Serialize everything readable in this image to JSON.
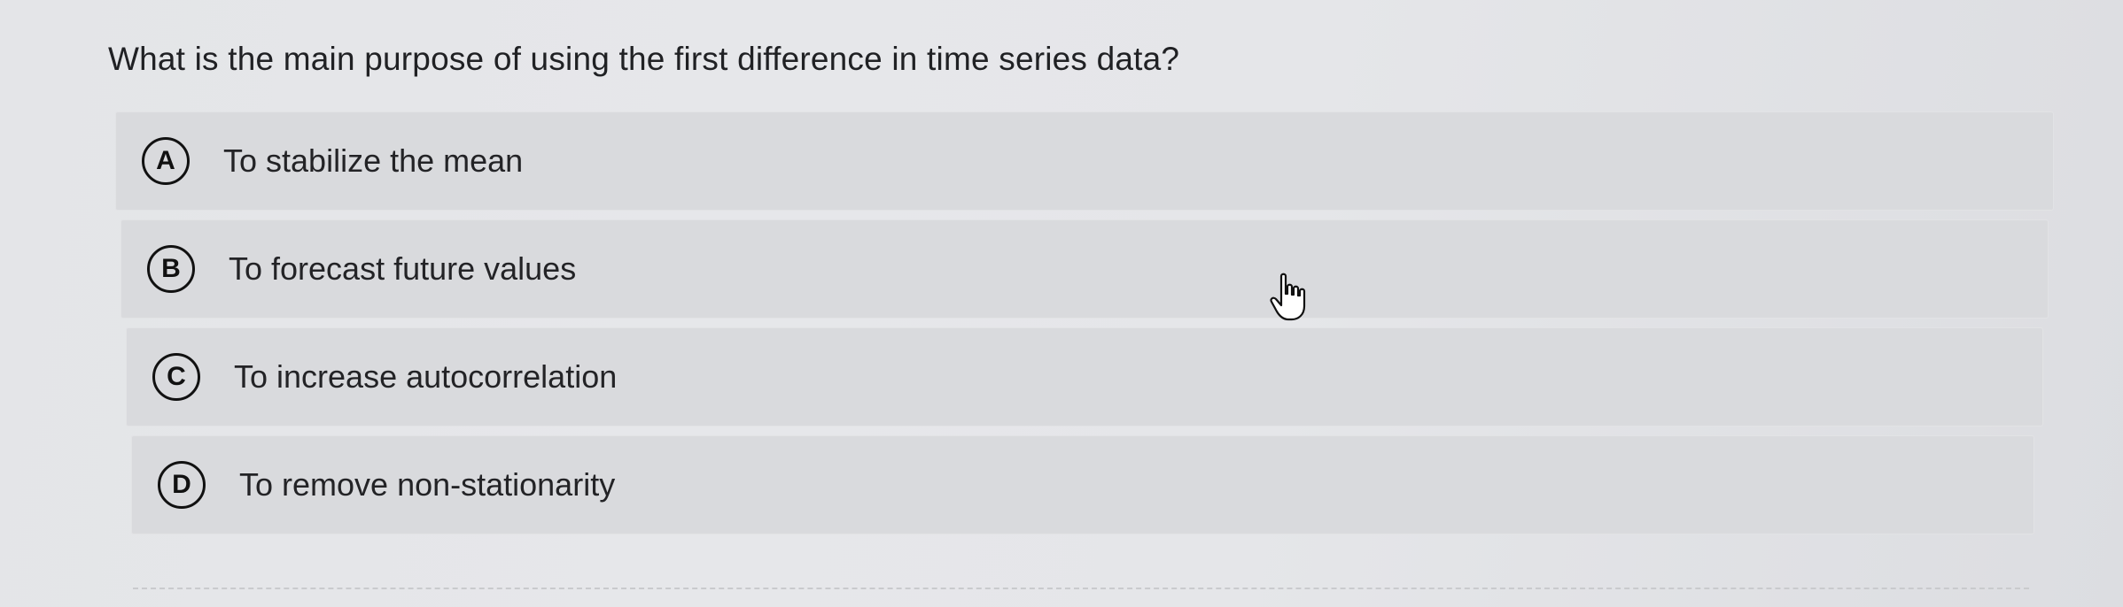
{
  "question": {
    "text": "What is the main purpose of using the first difference in time series data?"
  },
  "options": [
    {
      "letter": "A",
      "text": "To stabilize the mean"
    },
    {
      "letter": "B",
      "text": "To forecast future values"
    },
    {
      "letter": "C",
      "text": "To increase autocorrelation"
    },
    {
      "letter": "D",
      "text": "To remove non-stationarity"
    }
  ],
  "cursor": {
    "icon": "hand-pointer-icon"
  }
}
